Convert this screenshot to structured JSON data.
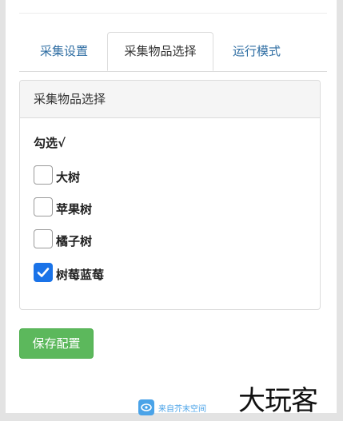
{
  "tabs": [
    {
      "label": "采集设置",
      "active": false
    },
    {
      "label": "采集物品选择",
      "active": true
    },
    {
      "label": "运行模式",
      "active": false
    }
  ],
  "card": {
    "title": "采集物品选择",
    "hint": "勾选√",
    "items": [
      {
        "label": "大树",
        "checked": false
      },
      {
        "label": "苹果树",
        "checked": false
      },
      {
        "label": "橘子树",
        "checked": false
      },
      {
        "label": "树莓蓝莓",
        "checked": true
      }
    ]
  },
  "save_label": "保存配置",
  "footer": {
    "source_text": "来自芥末空间",
    "watermark": "大玩客"
  },
  "colors": {
    "accent": "#1a73e8",
    "tab_link": "#2f6ea3",
    "success": "#5cb85c",
    "source_blue": "#4aa3e8"
  }
}
